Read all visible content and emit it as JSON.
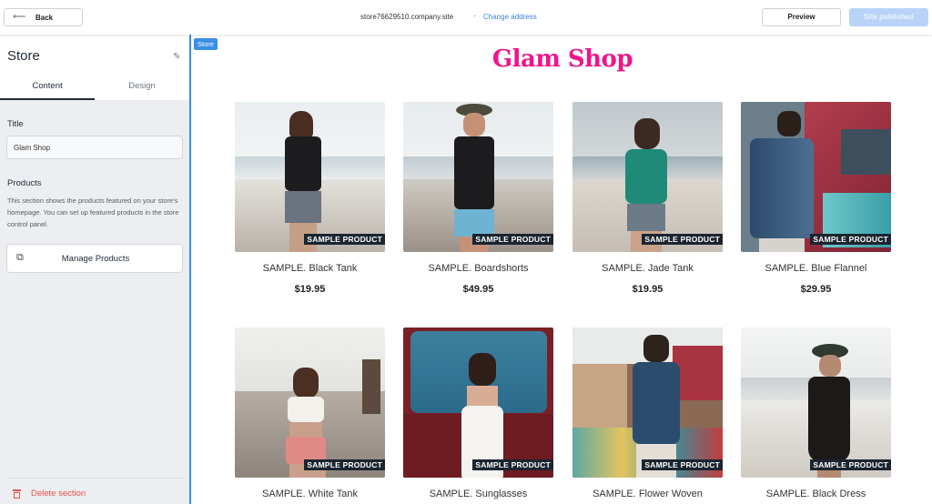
{
  "topbar": {
    "back_label": "Back",
    "back_icon": "arrow-left-icon",
    "site_address": "store76629510.company.site",
    "separator": "·",
    "change_address_label": "Change address",
    "preview_label": "Preview",
    "published_label": "Site published"
  },
  "sidebar": {
    "title": "Store",
    "edit_icon": "pencil-icon",
    "tabs": [
      {
        "label": "Content",
        "active": true
      },
      {
        "label": "Design",
        "active": false
      }
    ],
    "title_label": "Title",
    "title_value": "Glam Shop",
    "products_label": "Products",
    "products_description": "This section shows the products featured on your store's homepage. You can set up featured products in the store control panel.",
    "manage_products_label": "Manage Products",
    "manage_products_icon": "external-link-icon",
    "delete_label": "Delete section",
    "delete_icon": "trash-icon"
  },
  "preview": {
    "section_badge": "Store",
    "shop_title": "Glam Shop",
    "accent_color": "#f0148a",
    "products": [
      {
        "name": "SAMPLE. Black Tank",
        "price": "$19.95",
        "badge": "SAMPLE PRODUCT"
      },
      {
        "name": "SAMPLE. Boardshorts",
        "price": "$49.95",
        "badge": "SAMPLE PRODUCT"
      },
      {
        "name": "SAMPLE. Jade Tank",
        "price": "$19.95",
        "badge": "SAMPLE PRODUCT"
      },
      {
        "name": "SAMPLE. Blue Flannel",
        "price": "$29.95",
        "badge": "SAMPLE PRODUCT"
      },
      {
        "name": "SAMPLE. White Tank",
        "price": "",
        "badge": "SAMPLE PRODUCT"
      },
      {
        "name": "SAMPLE. Sunglasses",
        "price": "",
        "badge": "SAMPLE PRODUCT"
      },
      {
        "name": "SAMPLE. Flower Woven",
        "price": "",
        "badge": "SAMPLE PRODUCT"
      },
      {
        "name": "SAMPLE. Black Dress",
        "price": "",
        "badge": "SAMPLE PRODUCT"
      }
    ]
  }
}
